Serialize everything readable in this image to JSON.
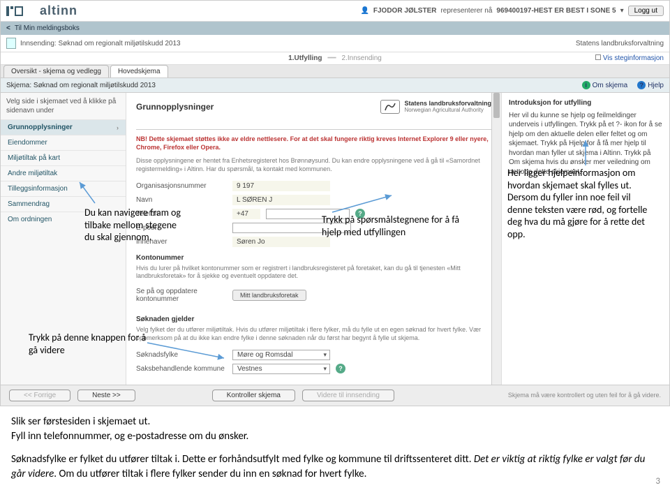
{
  "topbar": {
    "logo_text": "altinn",
    "user_icon": "👤",
    "user_name": "FJODOR JØLSTER",
    "user_rep": "representerer nå",
    "user_org": "969400197-HEST ER BEST I SONE 5",
    "chev": "▾",
    "logout": "Logg ut"
  },
  "bluestrip": {
    "chev": "<",
    "text": "Til Min meldingsboks"
  },
  "title_row": {
    "title": "Innsending: Søknad om regionalt miljøtilskudd 2013",
    "right": "Statens landbruksforvaltning"
  },
  "steps": {
    "s1": "1.Utfylling",
    "s2": "2.Innsending",
    "link": "Vis steginformasjon"
  },
  "tabs": {
    "t1": "Oversikt - skjema og vedlegg",
    "t2": "Hovedskjema"
  },
  "subtitle": "Skjema: Søknad om regionalt miljøtilskudd 2013",
  "help_links": {
    "om": "Om skjema",
    "hjelp": "Hjelp"
  },
  "sidebar": {
    "hint": "Velg side i skjemaet ved å klikke på sidenavn under",
    "items": [
      "Grunnopplysninger",
      "Eiendommer",
      "Miljøtiltak på kart",
      "Andre miljøtiltak",
      "Tilleggsinformasjon",
      "Sammendrag",
      "Om ordningen"
    ]
  },
  "form": {
    "header": "Grunnopplysninger",
    "agency_name": "Statens landbruksforvaltning",
    "agency_sub": "Norwegian Agricultural Authority",
    "warn": "NB! Dette skjemaet støttes ikke av eldre nettlesere. For at det skal fungere riktig kreves Internet Explorer 9 eller nyere, Chrome, Firefox eller Opera.",
    "info": "Disse opplysningene er hentet fra Enhetsregisteret hos Brønnøysund. Du kan endre opplysningene ved å gå til «Samordnet registermelding» i Altinn. Har du spørsmål, ta kontakt med kommunen.",
    "fields": {
      "orgnr_label": "Organisasjonsnummer",
      "orgnr_value": "9          197",
      "navn_label": "Navn",
      "navn_value": "L           SØREN J",
      "tlf_label": "Telefon",
      "tlf_prefix": "+47",
      "epost_label": "E-post",
      "innehaver_label": "Innehaver",
      "innehaver_value": "Søren Jo"
    },
    "konto_head": "Kontonummer",
    "konto_info": "Hvis du lurer på hvilket kontonummer som er registrert i landbruksregisteret på foretaket, kan du gå til tjenesten «Mitt landbruksforetak» for å sjekke og eventuelt oppdatere det.",
    "konto_btn_label": "Se på og oppdatere kontonummer",
    "konto_btn": "Mitt landbruksforetak",
    "soknad_head": "Søknaden gjelder",
    "soknad_info": "Velg fylket der du utfører miljøtiltak. Hvis du utfører miljøtiltak i flere fylker, må du fylle ut en egen søknad for hvert fylke. Vær oppmerksom på at du ikke kan endre fylke i denne søknaden når du først har begynt å fylle ut skjema.",
    "fylke_label": "Søknadsfylke",
    "fylke_value": "Møre og Romsdal",
    "kommune_label": "Saksbehandlende kommune",
    "kommune_value": "Vestnes"
  },
  "rightpane": {
    "heading": "Introduksjon for utfylling",
    "body": "Her vil du kunne se hjelp og feilmeldinger underveis i utfyllingen. Trykk på et ?- ikon for å se hjelp om den aktuelle delen eller feltet og om skjemaet. Trykk på Hjelp for å få mer hjelp til hvordan man fyller ut skjema i Altinn. Trykk på Om skjema hvis du ønsker mer veiledning om nettopp dette skjemaet."
  },
  "footer": {
    "prev": "<< Forrige",
    "next": "Neste >>",
    "kontroller": "Kontroller skjema",
    "videre": "Videre til innsending",
    "note": "Skjema må være kontrollert og uten feil for å gå videre."
  },
  "annotations": {
    "a1": "Du kan navigere fram og tilbake mellom stegene du skal gjennom.",
    "a2": "Trykk på spørsmålstegnene for å få hjelp med utfyllingen",
    "a3": "Her ligger hjelpeinformasjon om hvordan skjemaet skal fylles ut. Dersom du fyller inn noe feil vil denne teksten være rød, og fortelle deg hva du må gjøre for å rette det opp.",
    "a4": "Trykk på denne knappen for å gå videre"
  },
  "below": {
    "p1": "Slik ser førstesiden i skjemaet ut.",
    "p2": "Fyll inn telefonnummer, og e-postadresse om du ønsker.",
    "p3a": "Søknadsfylke er fylket du utfører tiltak i. Dette er forhåndsutfylt med fylke og kommune til driftssenteret ditt. ",
    "p3b": "Det er viktig at riktig fylke er valgt før du går videre",
    "p3c": ". Om du utfører tiltak i flere fylker sender du inn en søknad for hvert fylke."
  },
  "page_num": "3"
}
